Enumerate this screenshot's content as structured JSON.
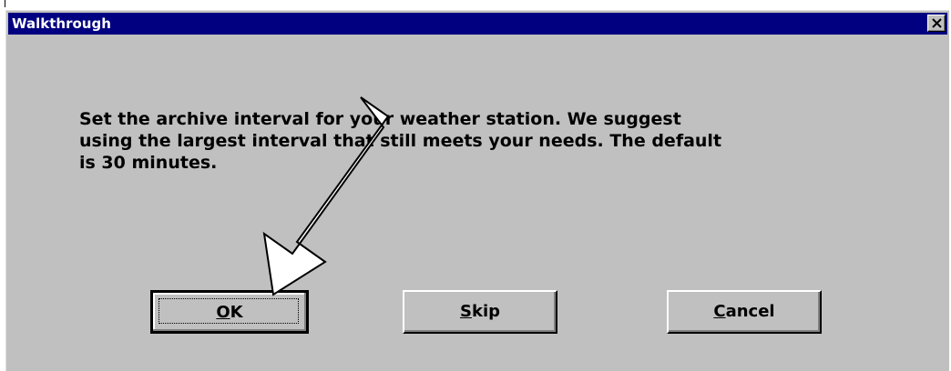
{
  "dialog": {
    "title": "Walkthrough",
    "close_label": "Close",
    "message": "Set the archive interval for your weather station.  We suggest\nusing the largest interval that still meets your needs.  The default\nis 30 minutes."
  },
  "buttons": {
    "ok": {
      "mnemonic": "O",
      "rest": "K"
    },
    "skip": {
      "mnemonic": "S",
      "rest": "kip"
    },
    "cancel": {
      "mnemonic": "C",
      "rest": "ancel"
    }
  },
  "colors": {
    "title_bar": "#000080",
    "face": "#c0c0c0",
    "pointer_arrow": "#ffffff"
  },
  "overlay": {
    "pointer": "arrow pointing to the OK button"
  }
}
